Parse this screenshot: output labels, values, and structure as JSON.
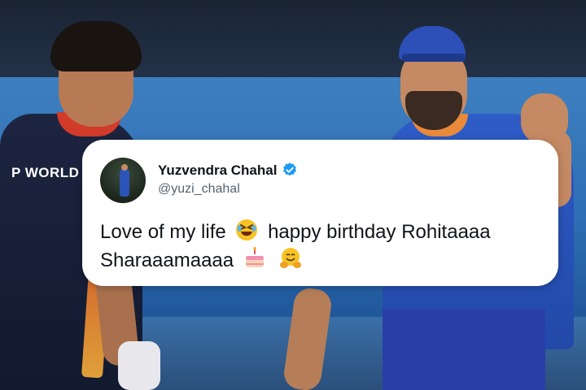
{
  "background": {
    "jersey_text": "P WORLD"
  },
  "tweet": {
    "display_name": "Yuzvendra Chahal",
    "handle": "@yuzi_chahal",
    "verified": true,
    "text_part1": "Love of my life",
    "text_part2": "happy birthday Rohitaaaa",
    "text_part3": "Sharaaamaaaa",
    "emojis": [
      "rolling-on-floor-laughing",
      "birthday-cake",
      "hugging-face"
    ]
  },
  "colors": {
    "verified_blue": "#1d9bf0",
    "card_bg": "#ffffff",
    "handle_gray": "#536471"
  }
}
